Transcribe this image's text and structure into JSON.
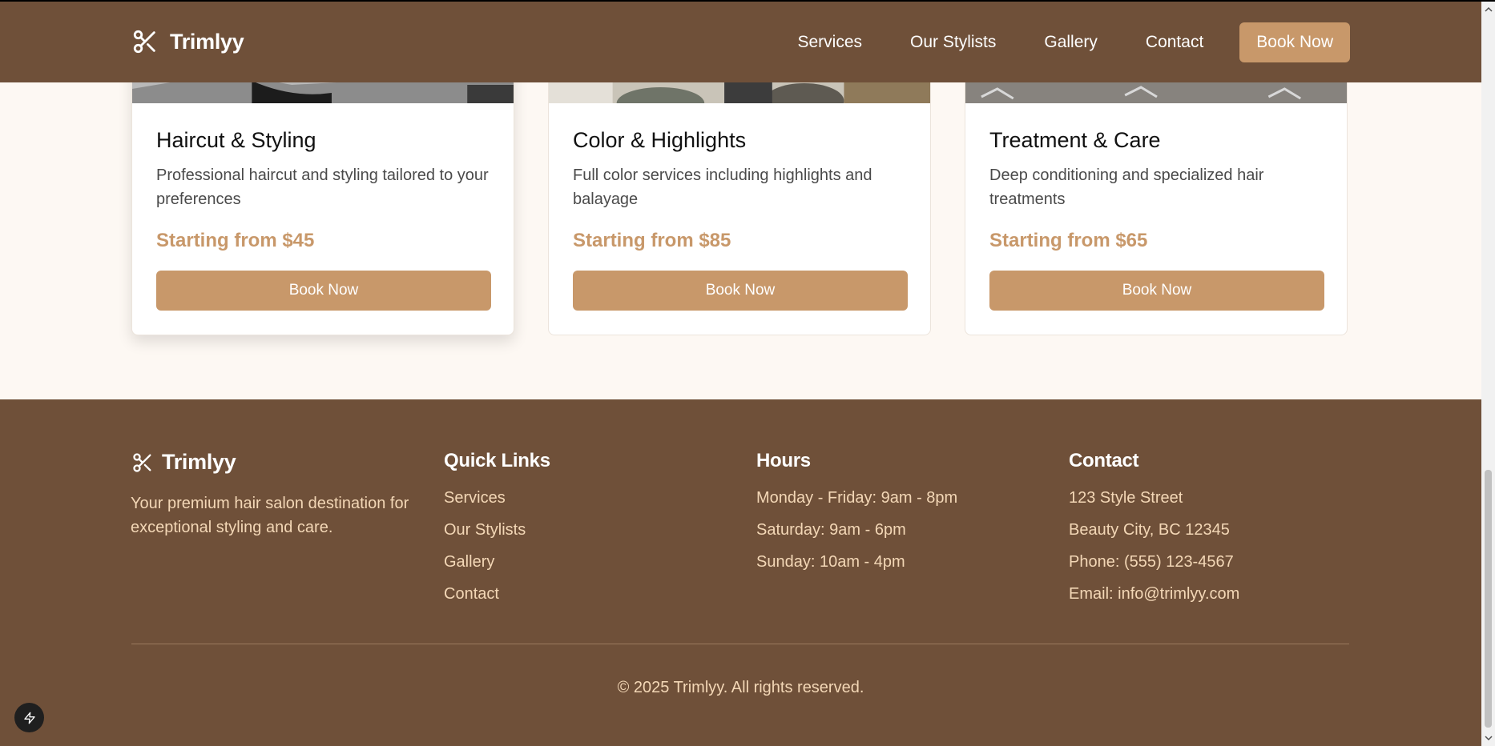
{
  "header": {
    "brand": "Trimlyy",
    "nav": [
      "Services",
      "Our Stylists",
      "Gallery",
      "Contact"
    ],
    "cta": "Book Now"
  },
  "services": [
    {
      "title": "Haircut & Styling",
      "description": "Professional haircut and styling tailored to your preferences",
      "price": "Starting from $45",
      "button": "Book Now"
    },
    {
      "title": "Color & Highlights",
      "description": "Full color services including highlights and balayage",
      "price": "Starting from $85",
      "button": "Book Now"
    },
    {
      "title": "Treatment & Care",
      "description": "Deep conditioning and specialized hair treatments",
      "price": "Starting from $65",
      "button": "Book Now"
    }
  ],
  "footer": {
    "brand": "Trimlyy",
    "tagline": "Your premium hair salon destination for exceptional styling and care.",
    "quick_links": {
      "heading": "Quick Links",
      "items": [
        "Services",
        "Our Stylists",
        "Gallery",
        "Contact"
      ]
    },
    "hours": {
      "heading": "Hours",
      "items": [
        "Monday - Friday: 9am - 8pm",
        "Saturday: 9am - 6pm",
        "Sunday: 10am - 4pm"
      ]
    },
    "contact": {
      "heading": "Contact",
      "items": [
        "123 Style Street",
        "Beauty City, BC 12345",
        "Phone: (555) 123-4567",
        "Email: info@trimlyy.com"
      ]
    },
    "copyright": "© 2025 Trimlyy. All rights reserved."
  },
  "colors": {
    "brown": "#6f5039",
    "accent": "#c8986a",
    "cream": "#fdf8f3",
    "footer_text": "#f3d7b6"
  },
  "icons": [
    "scissors-icon",
    "lightning-icon",
    "chevron-up-icon",
    "chevron-down-icon"
  ]
}
